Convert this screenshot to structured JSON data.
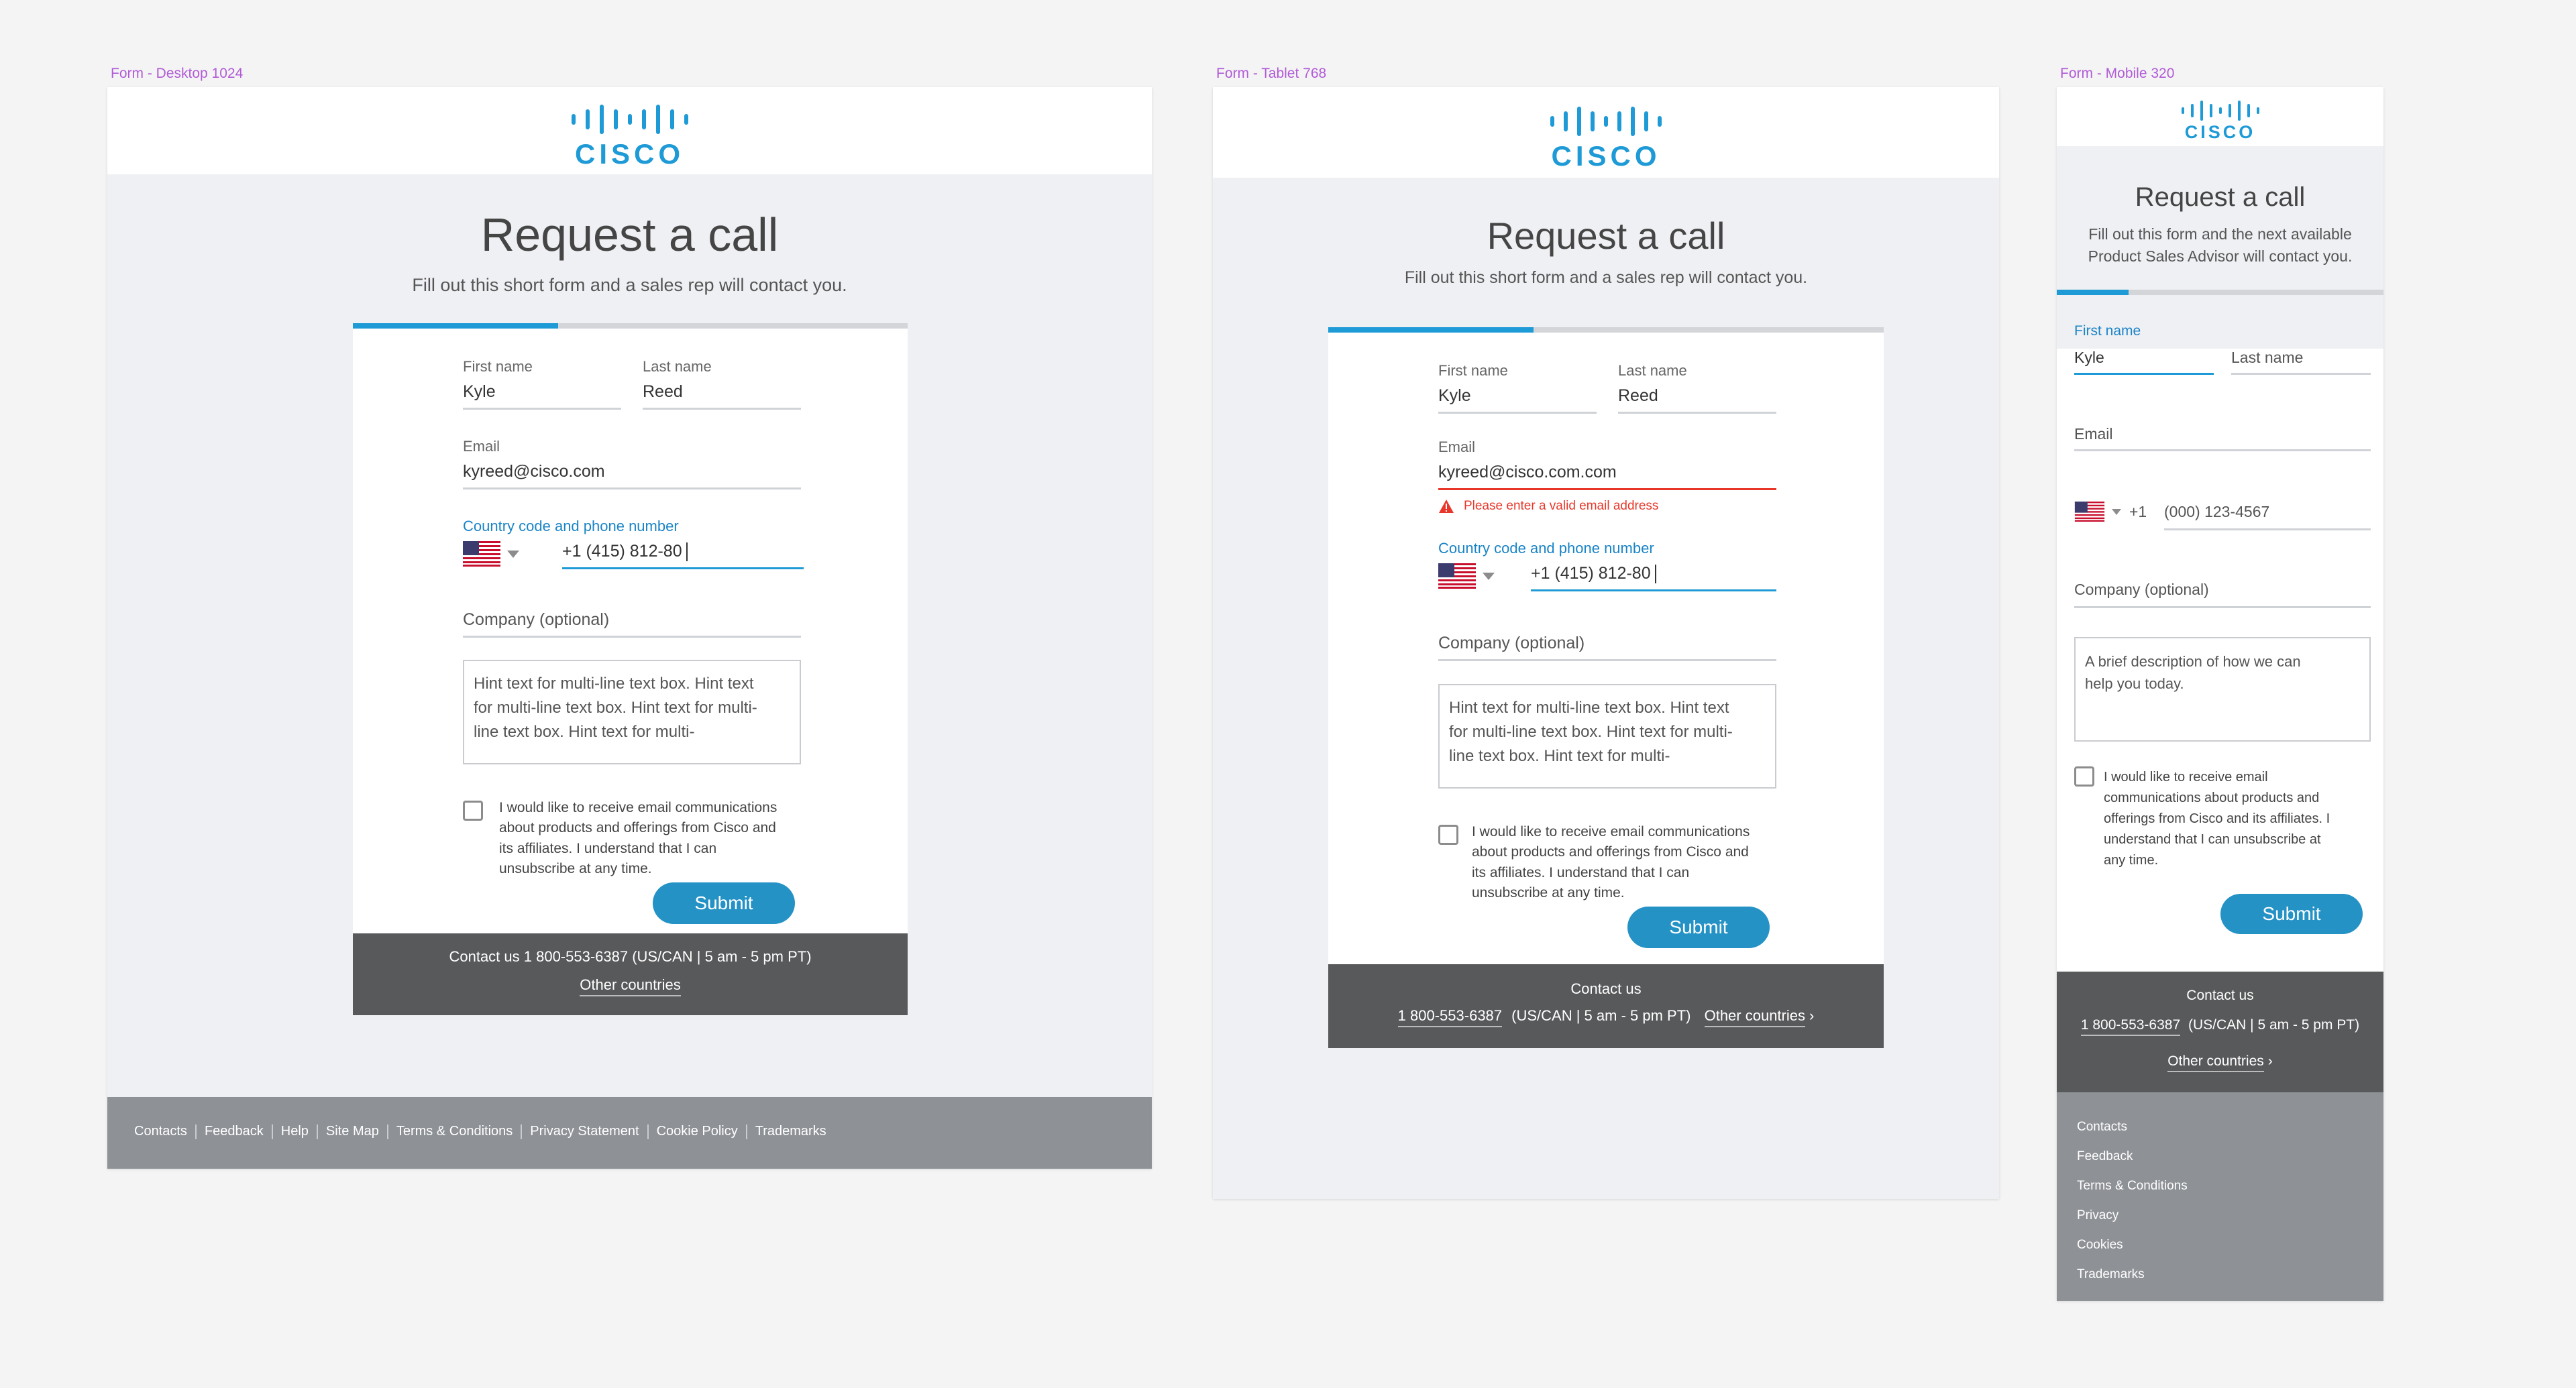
{
  "frames": {
    "desktop": {
      "label": "Form - Desktop 1024"
    },
    "tablet": {
      "label": "Form - Tablet 768"
    },
    "mobile": {
      "label": "Form - Mobile 320"
    }
  },
  "brand": {
    "logo_text": "CISCO",
    "accent": "#1e9ad6",
    "error": "#e8372a",
    "button": "#2592c6"
  },
  "form": {
    "title": "Request a call",
    "subtitle": "Fill out this short form and a sales rep will contact you.",
    "subtitle_mobile": [
      "Fill out this form and the next available",
      "Product Sales Advisor will contact you."
    ],
    "first_name_label": "First name",
    "first_name_value": "Kyle",
    "last_name_label": "Last name",
    "last_name_value": "Reed",
    "email_label": "Email",
    "email_value_desktop": "kyreed@cisco.com",
    "email_value_tablet": "kyreed@cisco.com.com",
    "email_error": "Please enter a valid email address",
    "phone_label": "Country code and phone number",
    "phone_value": "+1 (415) 812-80",
    "phone_code_mobile": "+1",
    "phone_placeholder_mobile": "(000) 123-4567",
    "company_label": "Company (optional)",
    "textarea_lines": [
      "Hint text for multi-line text box. Hint text",
      "for multi-line text box. Hint text for multi-",
      "line text box. Hint text for multi-"
    ],
    "textarea_mobile_lines": [
      "A brief description of how we can",
      "help you today."
    ],
    "consent_lines": [
      "I would like to receive email communications",
      "about products and offerings from Cisco and",
      "its affiliates. I understand that I can",
      "unsubscribe at any time."
    ],
    "consent_lines_desktop": [
      "I would like to receive email communications",
      "about products and offerings from Cisco and",
      "its affiliates. I understand that I can",
      "unsubscribe at any time."
    ],
    "consent_lines_mobile": [
      "I would like to receive email",
      "communications about products and",
      "offerings from Cisco and its affiliates. I",
      "understand that I can unsubscribe at",
      "any time."
    ],
    "submit_label": "Submit",
    "progress_fraction": 0.37,
    "progress_fraction_mobile": 0.22
  },
  "contact": {
    "desktop_line": "Contact us 1 800-553-6387 (US/CAN | 5 am - 5 pm PT)",
    "contact_us": "Contact us",
    "phone": "1 800-553-6387",
    "hours": "(US/CAN | 5 am - 5 pm PT)",
    "other_countries": "Other countries"
  },
  "footer": {
    "links": [
      "Contacts",
      "Feedback",
      "Help",
      "Site Map",
      "Terms & Conditions",
      "Privacy Statement",
      "Cookie Policy",
      "Trademarks"
    ],
    "mobile_links": [
      "Contacts",
      "Feedback",
      "Terms & Conditions",
      "Privacy",
      "Cookies",
      "Trademarks"
    ]
  }
}
